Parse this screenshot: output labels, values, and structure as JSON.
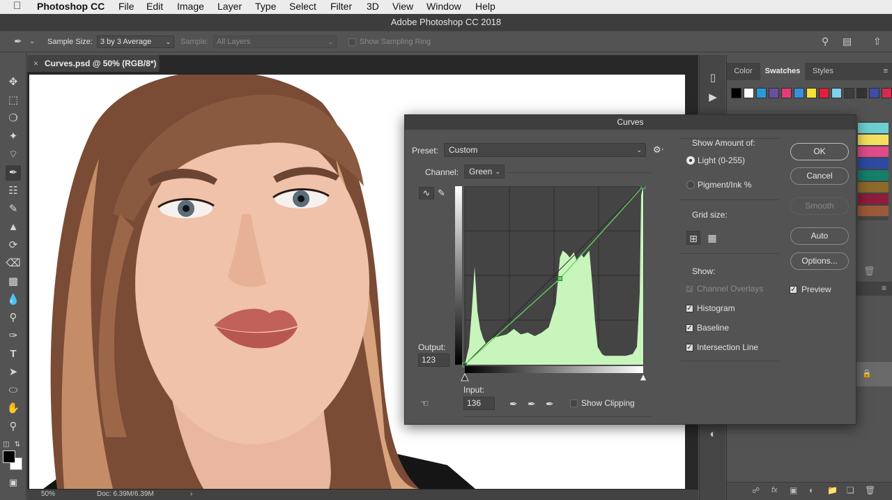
{
  "menubar": {
    "apple": "",
    "app": "Photoshop CC",
    "items": [
      "File",
      "Edit",
      "Image",
      "Layer",
      "Type",
      "Select",
      "Filter",
      "3D",
      "View",
      "Window",
      "Help"
    ]
  },
  "window_title": "Adobe Photoshop CC 2018",
  "options": {
    "sample_size_label": "Sample Size:",
    "sample_size_value": "3 by 3 Average",
    "sample_label": "Sample:",
    "sample_value": "All Layers",
    "show_ring_label": "Show Sampling Ring"
  },
  "document": {
    "tab_close": "×",
    "tab_title": "Curves.psd @ 50% (RGB/8*)",
    "zoom": "50%",
    "doc_size": "Doc: 6.39M/6.39M",
    "status_arrow": "›"
  },
  "panel": {
    "tabs": [
      "Color",
      "Swatches",
      "Styles"
    ],
    "active_tab": "Swatches",
    "swatch_colors": [
      "#000000",
      "#ffffff",
      "#2b9bd8",
      "#6a4fa0",
      "#e63b7a",
      "#3a8fd6",
      "#f2e23a",
      "#e0203a",
      "#7fd3ec",
      "#3d3d3d",
      "#333333",
      "#3c4ca8",
      "#d62a55"
    ]
  },
  "curves": {
    "title": "Curves",
    "preset_label": "Preset:",
    "preset_value": "Custom",
    "channel_label": "Channel:",
    "channel_value": "Green",
    "output_label": "Output:",
    "output_value": "123",
    "input_label": "Input:",
    "input_value": "136",
    "show_clipping_label": "Show Clipping",
    "show_amount_label": "Show Amount of:",
    "light_label": "Light  (0-255)",
    "pigment_label": "Pigment/Ink %",
    "grid_size_label": "Grid size:",
    "show_label": "Show:",
    "channel_overlays_label": "Channel Overlays",
    "histogram_label": "Histogram",
    "baseline_label": "Baseline",
    "intersection_label": "Intersection Line",
    "buttons": {
      "ok": "OK",
      "cancel": "Cancel",
      "smooth": "Smooth",
      "auto": "Auto",
      "options": "Options..."
    },
    "preview_label": "Preview",
    "curve_point": {
      "input": 136,
      "output": 123
    },
    "curve_color": "#63d163",
    "histogram_color": "#c8f5bb"
  }
}
